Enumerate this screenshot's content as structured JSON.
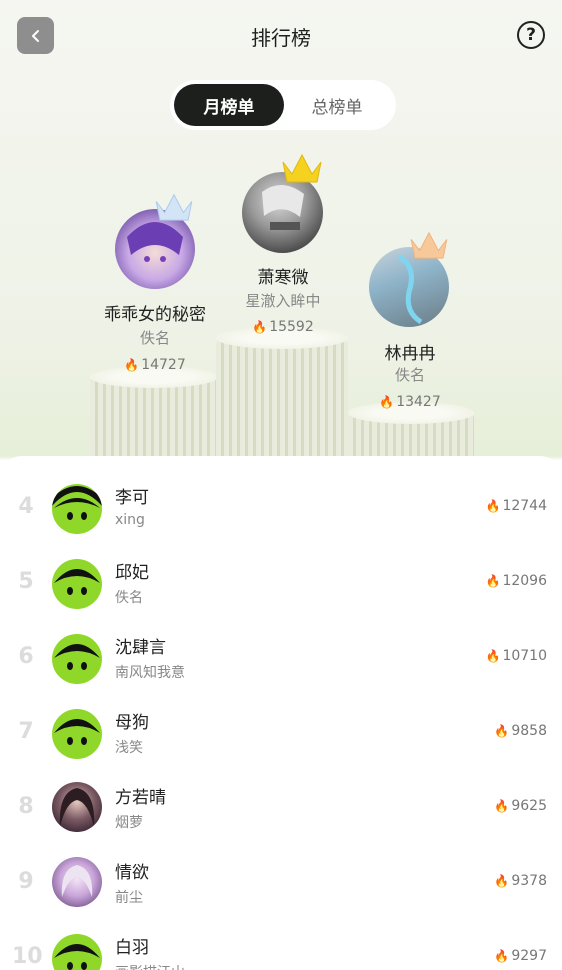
{
  "header": {
    "title": "排行榜"
  },
  "tabs": {
    "monthly": "月榜单",
    "overall": "总榜单"
  },
  "top3": [
    {
      "rank": 1,
      "name": "萧寒微",
      "sub": "星澈入眸中",
      "score": "15592"
    },
    {
      "rank": 2,
      "name": "乖乖女的秘密",
      "sub": "佚名",
      "score": "14727"
    },
    {
      "rank": 3,
      "name": "林冉冉",
      "sub": "佚名",
      "score": "13427"
    }
  ],
  "list": [
    {
      "rank": "4",
      "name": "李可",
      "sub": "xing",
      "score": "12744"
    },
    {
      "rank": "5",
      "name": "邱妃",
      "sub": "佚名",
      "score": "12096"
    },
    {
      "rank": "6",
      "name": "沈肆言",
      "sub": "南风知我意",
      "score": "10710"
    },
    {
      "rank": "7",
      "name": "母狗",
      "sub": "浅笑",
      "score": "9858"
    },
    {
      "rank": "8",
      "name": "方若晴",
      "sub": "烟萝",
      "score": "9625"
    },
    {
      "rank": "9",
      "name": "情欲",
      "sub": "前尘",
      "score": "9378"
    },
    {
      "rank": "10",
      "name": "白羽",
      "sub": "画影描江山",
      "score": "9297"
    }
  ],
  "icons": {
    "back": "chevron-left-icon",
    "help": "question-circle-icon",
    "flame": "flame-icon",
    "crown": "crown-icon"
  },
  "colors": {
    "accent_dark": "#1d1f1c",
    "flame": "#f06b22",
    "crown_gold": "#f5d21f",
    "crown_silver": "#a9c9ee",
    "crown_bronze": "#f0b27a",
    "default_avatar_green": "#8fd82a"
  }
}
